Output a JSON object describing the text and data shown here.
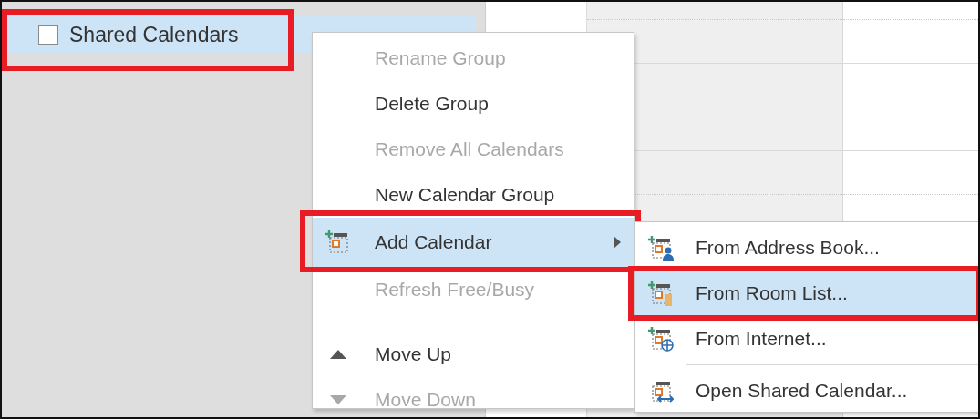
{
  "sidebar": {
    "group": {
      "label": "Shared Calendars",
      "checked": false,
      "selected": true,
      "outlined": true
    }
  },
  "context_menu": {
    "items": [
      {
        "kind": "item",
        "label": "Rename Group",
        "disabled": true,
        "selected": false,
        "outlined": false
      },
      {
        "kind": "item",
        "label": "Delete Group",
        "disabled": false,
        "selected": false,
        "outlined": false
      },
      {
        "kind": "item",
        "label": "Remove All Calendars",
        "disabled": true,
        "selected": false,
        "outlined": false
      },
      {
        "kind": "item",
        "label": "New Calendar Group",
        "disabled": false,
        "selected": false,
        "outlined": false
      },
      {
        "kind": "submenu",
        "label": "Add Calendar",
        "disabled": false,
        "selected": true,
        "outlined": true
      },
      {
        "kind": "item",
        "label": "Refresh Free/Busy",
        "disabled": true,
        "selected": false,
        "outlined": false
      },
      {
        "kind": "separator"
      },
      {
        "kind": "item",
        "label": "Move Up",
        "disabled": false,
        "selected": false,
        "outlined": false
      },
      {
        "kind": "item",
        "label": "Move Down",
        "disabled": true,
        "selected": false,
        "outlined": false
      }
    ]
  },
  "submenu": {
    "items": [
      {
        "kind": "item",
        "label": "From Address Book...",
        "selected": false,
        "outlined": false
      },
      {
        "kind": "item",
        "label": "From Room List...",
        "selected": true,
        "outlined": true
      },
      {
        "kind": "item",
        "label": "From Internet...",
        "selected": false,
        "outlined": false
      },
      {
        "kind": "separator"
      },
      {
        "kind": "item",
        "label": "Open Shared Calendar...",
        "selected": false,
        "outlined": false
      }
    ]
  }
}
